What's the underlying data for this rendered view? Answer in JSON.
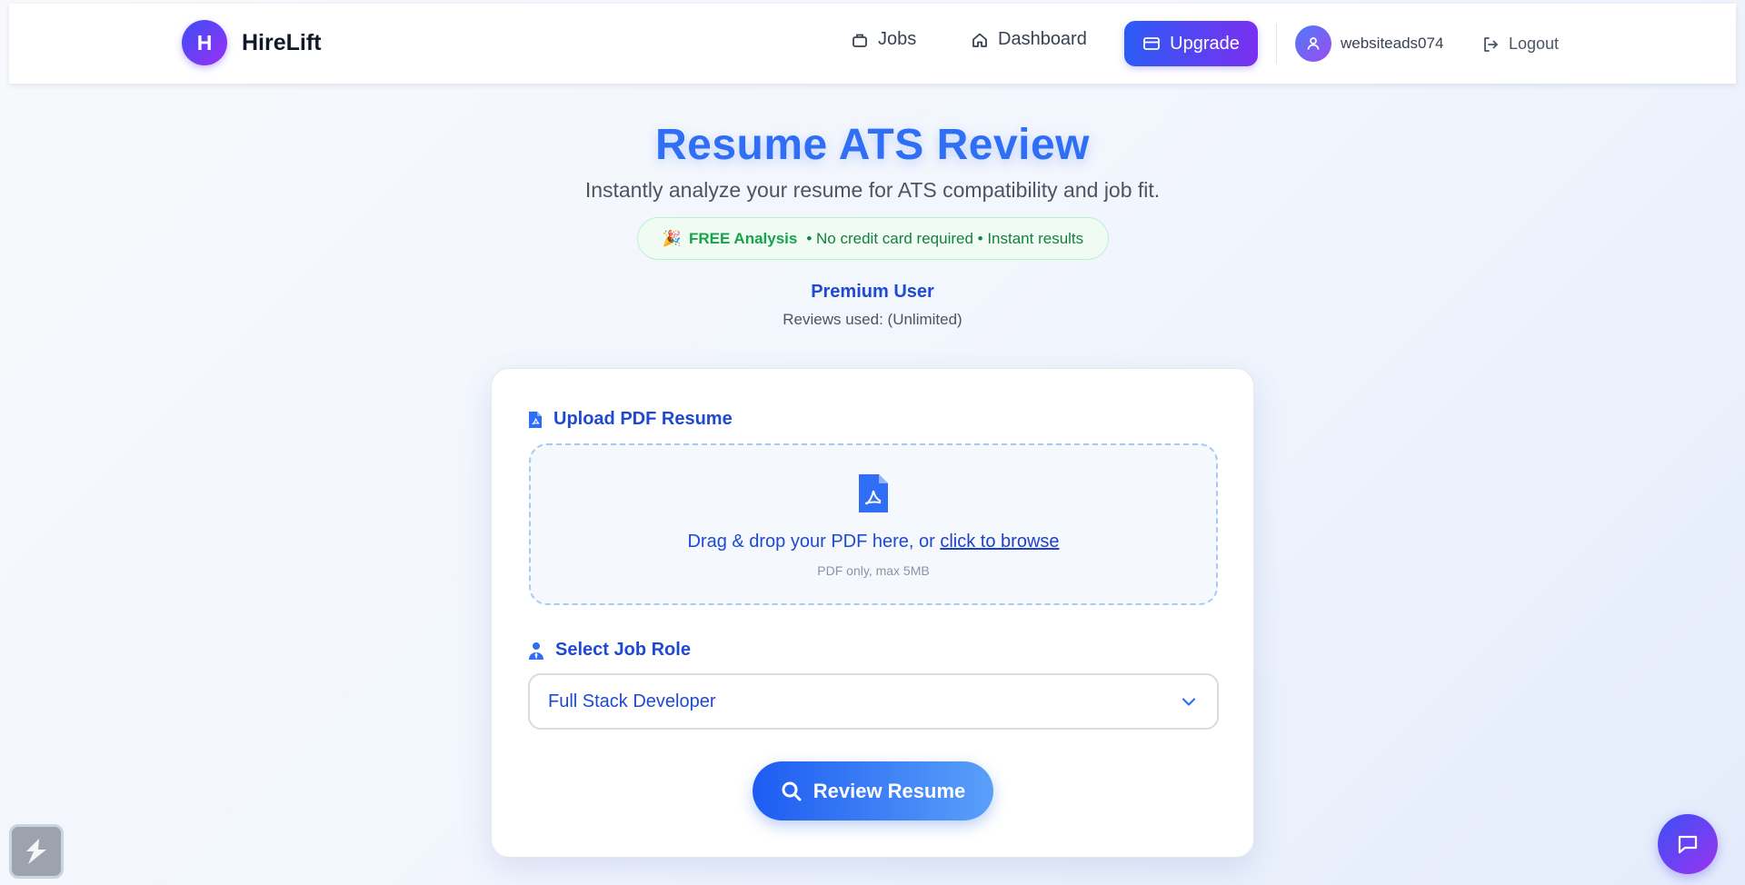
{
  "brand": {
    "logo_letter": "H",
    "name": "HireLift"
  },
  "nav": {
    "jobs_label": "Jobs",
    "dashboard_label": "Dashboard",
    "upgrade_label": "Upgrade",
    "username": "websiteads074",
    "logout_label": "Logout"
  },
  "hero": {
    "title": "Resume ATS Review",
    "subtitle": "Instantly analyze your resume for ATS compatibility and job fit.",
    "badge_emoji": "🎉",
    "badge_strong": "FREE Analysis",
    "badge_text": "• No credit card required • Instant results",
    "plan_label": "Premium User",
    "reviews_used": "Reviews used: (Unlimited)"
  },
  "upload": {
    "label": "Upload PDF Resume",
    "drop_text": "Drag & drop your PDF here, or ",
    "browse_link": "click to browse",
    "hint": "PDF only, max 5MB"
  },
  "job_role": {
    "label": "Select Job Role",
    "selected": "Full Stack Developer"
  },
  "review_button": "Review Resume",
  "icons": {
    "jobs": "briefcase-icon",
    "dashboard": "home-icon",
    "upgrade": "credit-card-icon",
    "user": "user-icon",
    "logout": "logout-icon",
    "pdf": "pdf-file-icon",
    "role": "user-tie-icon",
    "chevron": "chevron-down-icon",
    "search": "search-icon",
    "chat": "chat-icon"
  },
  "colors": {
    "primary": "#2f6ef5",
    "accent_purple": "#7b2ff0",
    "success": "#16a34a",
    "label_blue": "#1e49d1"
  }
}
